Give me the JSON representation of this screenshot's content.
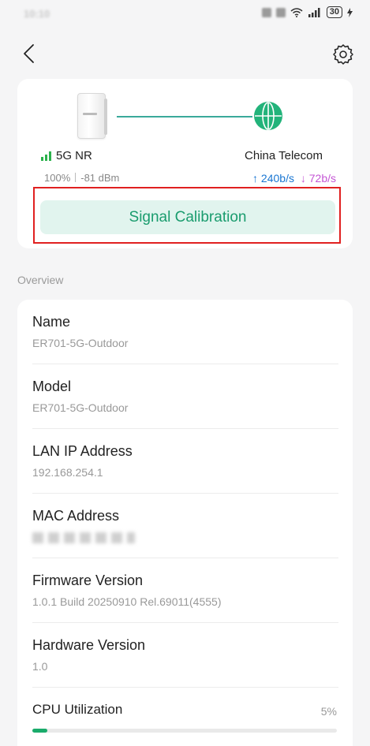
{
  "status_bar": {
    "time": "10:10",
    "battery": "30"
  },
  "hero": {
    "network_type": "5G NR",
    "signal_percent": "100%",
    "signal_dbm": "-81 dBm",
    "carrier": "China Telecom",
    "upload_speed": "240b/s",
    "download_speed": "72b/s",
    "calibrate_button": "Signal Calibration"
  },
  "overview": {
    "section_label": "Overview",
    "rows": [
      {
        "label": "Name",
        "value": "ER701-5G-Outdoor"
      },
      {
        "label": "Model",
        "value": "ER701-5G-Outdoor"
      },
      {
        "label": "LAN IP Address",
        "value": "192.168.254.1"
      },
      {
        "label": "MAC Address",
        "value": ""
      },
      {
        "label": "Firmware Version",
        "value": "1.0.1 Build 20250910 Rel.69011(4555)"
      },
      {
        "label": "Hardware Version",
        "value": "1.0"
      }
    ],
    "cpu": {
      "label": "CPU Utilization",
      "value_text": "5%",
      "fraction": 0.05
    }
  },
  "colors": {
    "accent": "#1a9c6e",
    "upload": "#1976d2",
    "download": "#c455d4",
    "highlight": "#e02020"
  },
  "icons": {
    "back": "chevron-left-icon",
    "settings": "gear-icon",
    "router": "router-image",
    "globe": "globe-icon",
    "signal": "signal-bars-icon"
  }
}
